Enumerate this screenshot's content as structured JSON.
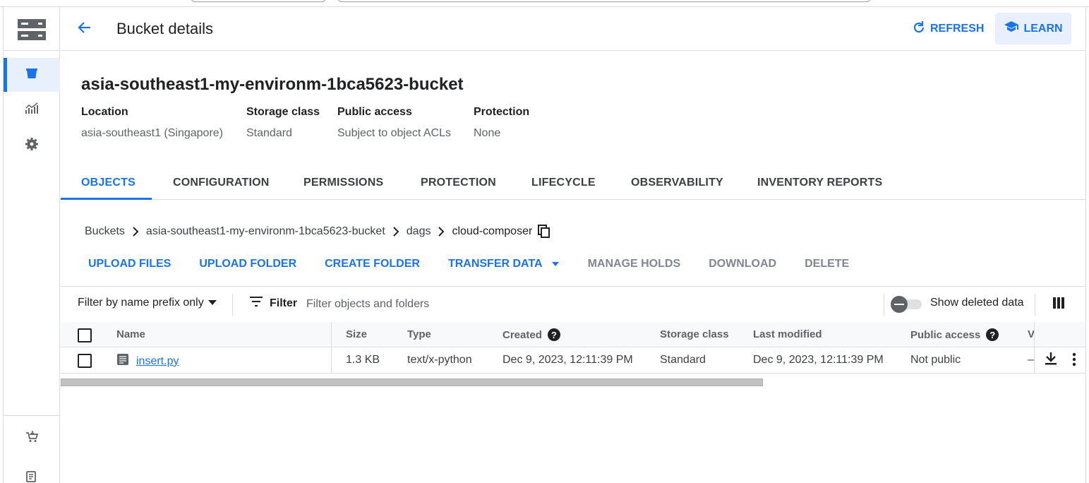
{
  "header": {
    "title": "Bucket details",
    "refresh_label": "REFRESH",
    "learn_label": "LEARN"
  },
  "bucket": {
    "name": "asia-southeast1-my-environm-1bca5623-bucket",
    "info": [
      {
        "label": "Location",
        "value": "asia-southeast1 (Singapore)"
      },
      {
        "label": "Storage class",
        "value": "Standard"
      },
      {
        "label": "Public access",
        "value": "Subject to object ACLs"
      },
      {
        "label": "Protection",
        "value": "None"
      }
    ]
  },
  "tabs": [
    {
      "label": "OBJECTS",
      "active": true
    },
    {
      "label": "CONFIGURATION",
      "active": false
    },
    {
      "label": "PERMISSIONS",
      "active": false
    },
    {
      "label": "PROTECTION",
      "active": false
    },
    {
      "label": "LIFECYCLE",
      "active": false
    },
    {
      "label": "OBSERVABILITY",
      "active": false
    },
    {
      "label": "INVENTORY REPORTS",
      "active": false
    }
  ],
  "breadcrumb": [
    "Buckets",
    "asia-southeast1-my-environm-1bca5623-bucket",
    "dags",
    "cloud-composer"
  ],
  "actions": {
    "upload_files": "UPLOAD FILES",
    "upload_folder": "UPLOAD FOLDER",
    "create_folder": "CREATE FOLDER",
    "transfer_data": "TRANSFER DATA",
    "manage_holds": "MANAGE HOLDS",
    "download": "DOWNLOAD",
    "delete": "DELETE"
  },
  "filter": {
    "prefix_label": "Filter by name prefix only",
    "filter_label": "Filter",
    "placeholder": "Filter objects and folders",
    "show_deleted_label": "Show deleted data",
    "show_deleted_on": false
  },
  "table": {
    "columns": {
      "name": "Name",
      "size": "Size",
      "type": "Type",
      "created": "Created",
      "storage_class": "Storage class",
      "last_modified": "Last modified",
      "public_access": "Public access",
      "overflow": "V"
    },
    "rows": [
      {
        "name": "insert.py",
        "size": "1.3 KB",
        "type": "text/x-python",
        "created": "Dec 9, 2023, 12:11:39 PM",
        "storage_class": "Standard",
        "last_modified": "Dec 9, 2023, 12:11:39 PM",
        "public_access": "Not public",
        "overflow": "–"
      }
    ]
  },
  "colors": {
    "accent": "#1a73e8",
    "accent_bg": "#e8f0fe",
    "text": "#202124",
    "muted": "#5f6368",
    "divider": "#dadce0"
  },
  "icons": {
    "rail": [
      "storage-logo-icon",
      "bucket-icon",
      "monitoring-icon",
      "settings-icon",
      "marketplace-icon",
      "release-notes-icon"
    ]
  }
}
